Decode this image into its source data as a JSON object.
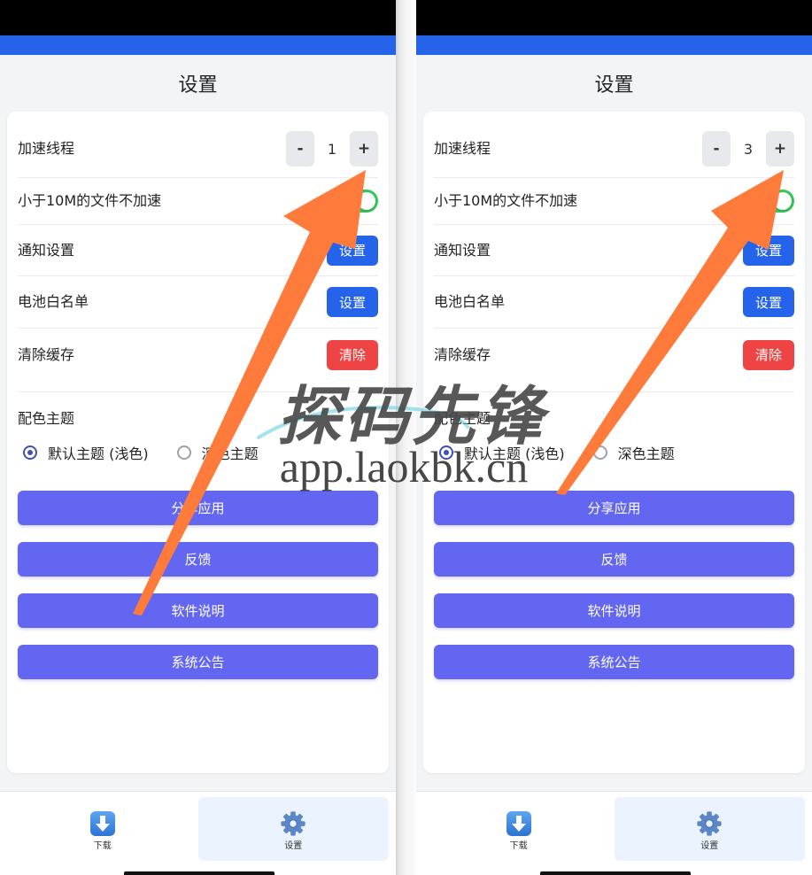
{
  "colors": {
    "status_bar": "#000000",
    "header_bar": "#2563eb",
    "page_background": "#f3f4f6",
    "primary_button": "#2563eb",
    "danger_button": "#ef4444",
    "action_button": "#6366f1",
    "toggle_on": "#34c759",
    "radio_selected": "#3f51b5",
    "annotation_arrow": "#ff7b3b"
  },
  "watermark": {
    "brand": "探码先锋",
    "url": "app.laokbk.cn"
  },
  "panels": [
    {
      "title": "设置",
      "thread": {
        "label": "加速线程",
        "decrement": "-",
        "value": 1,
        "increment": "+"
      },
      "skip_small_files": {
        "label": "小于10M的文件不加速",
        "enabled": true
      },
      "notification": {
        "label": "通知设置",
        "button": "设置"
      },
      "battery_whitelist": {
        "label": "电池白名单",
        "button": "设置"
      },
      "clear_cache": {
        "label": "清除缓存",
        "button": "清除"
      },
      "theme": {
        "label": "配色主题",
        "options": [
          {
            "label": "默认主题 (浅色)",
            "selected": true
          },
          {
            "label": "深色主题",
            "selected": false
          }
        ]
      },
      "actions": [
        "分享应用",
        "反馈",
        "软件说明",
        "系统公告"
      ],
      "nav": [
        {
          "label": "下载",
          "icon": "download-icon",
          "active": false
        },
        {
          "label": "设置",
          "icon": "gear-icon",
          "active": true
        }
      ]
    },
    {
      "title": "设置",
      "thread": {
        "label": "加速线程",
        "decrement": "-",
        "value": 3,
        "increment": "+"
      },
      "skip_small_files": {
        "label": "小于10M的文件不加速",
        "enabled": true
      },
      "notification": {
        "label": "通知设置",
        "button": "设置"
      },
      "battery_whitelist": {
        "label": "电池白名单",
        "button": "设置"
      },
      "clear_cache": {
        "label": "清除缓存",
        "button": "清除"
      },
      "theme": {
        "label": "配色主题",
        "options": [
          {
            "label": "默认主题 (浅色)",
            "selected": true
          },
          {
            "label": "深色主题",
            "selected": false
          }
        ]
      },
      "actions": [
        "分享应用",
        "反馈",
        "软件说明",
        "系统公告"
      ],
      "nav": [
        {
          "label": "下载",
          "icon": "download-icon",
          "active": false
        },
        {
          "label": "设置",
          "icon": "gear-icon",
          "active": true
        }
      ]
    }
  ]
}
